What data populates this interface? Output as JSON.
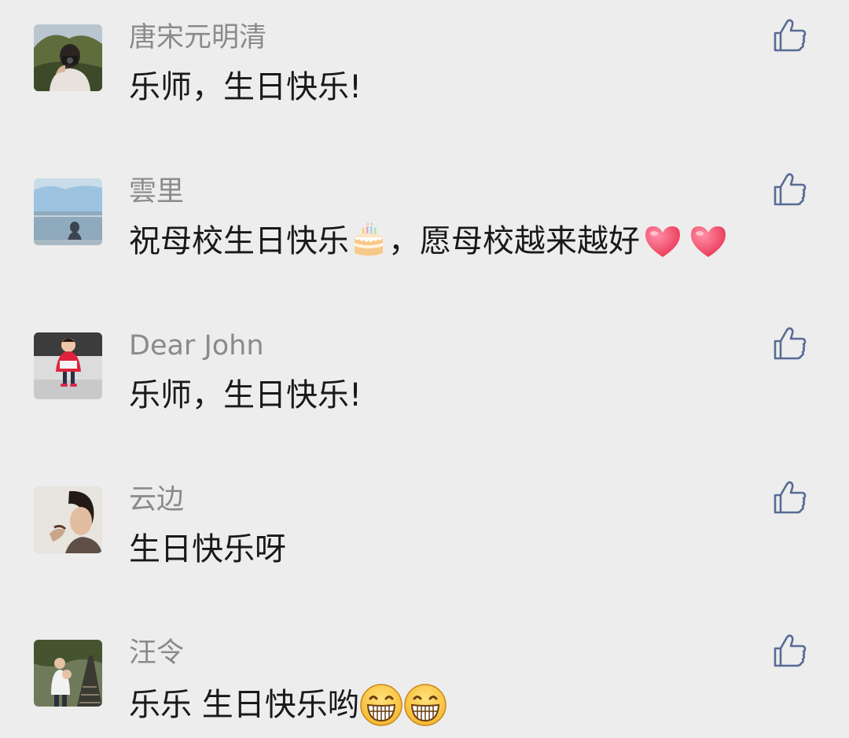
{
  "comments": [
    {
      "name": "唐宋元明清",
      "avatar_icon": "avatar-photographer",
      "segments": [
        {
          "type": "text",
          "value": "乐师，生日快乐!"
        }
      ]
    },
    {
      "name": "雲里",
      "avatar_icon": "avatar-seaside",
      "segments": [
        {
          "type": "text",
          "value": "祝母校生日快乐"
        },
        {
          "type": "emoji",
          "icon": "birthday-cake-icon"
        },
        {
          "type": "text",
          "value": "，愿母校越来越好"
        },
        {
          "type": "emoji",
          "icon": "red-heart-icon"
        },
        {
          "type": "emoji",
          "icon": "red-heart-icon"
        }
      ]
    },
    {
      "name": "Dear John",
      "avatar_icon": "avatar-child-red-coat",
      "segments": [
        {
          "type": "text",
          "value": "乐师，生日快乐!"
        }
      ]
    },
    {
      "name": "云边",
      "avatar_icon": "avatar-portrait",
      "segments": [
        {
          "type": "text",
          "value": "生日快乐呀"
        }
      ]
    },
    {
      "name": "汪令",
      "avatar_icon": "avatar-bridge",
      "segments": [
        {
          "type": "text",
          "value": "乐乐 生日快乐哟"
        },
        {
          "type": "emoji",
          "icon": "grinning-face-icon"
        },
        {
          "type": "emoji",
          "icon": "grinning-face-icon"
        }
      ]
    }
  ],
  "like_icon": "thumbs-up-icon",
  "colors": {
    "background": "#ededed",
    "name": "#8a8a8a",
    "text": "#191919",
    "like_icon": "#576b95"
  }
}
